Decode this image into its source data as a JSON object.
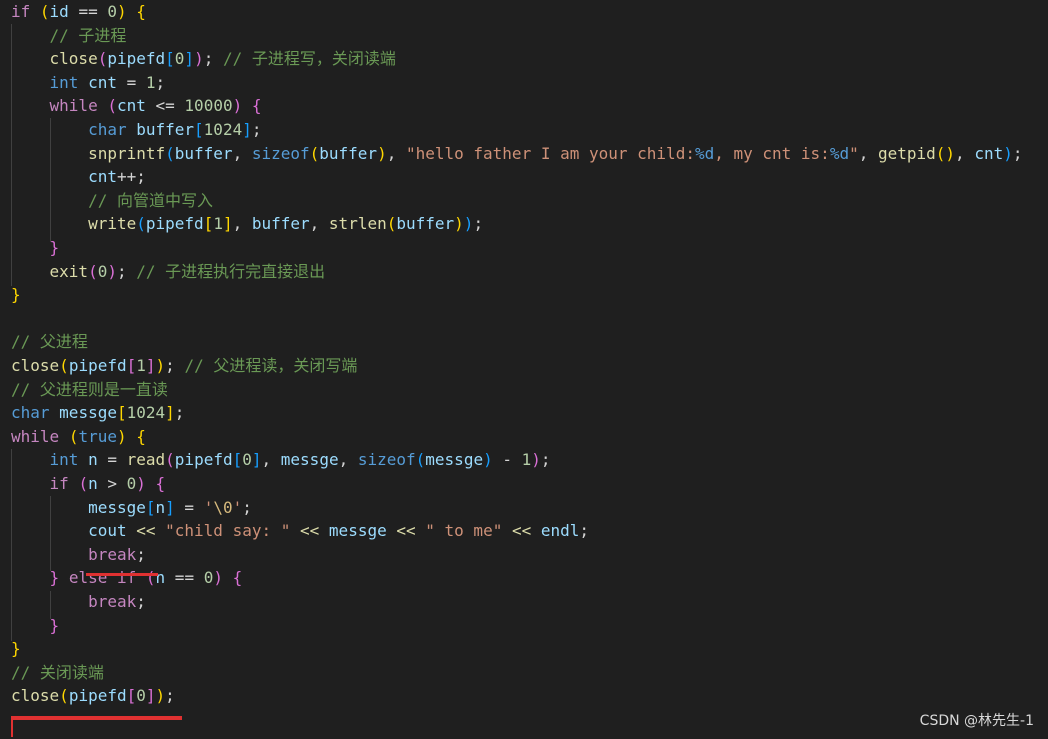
{
  "editor": {
    "watermark": "CSDN @林先生-1",
    "lines": [
      [
        [
          "k",
          "if"
        ],
        [
          "p",
          " "
        ],
        [
          "b1",
          "("
        ],
        [
          "v",
          "id"
        ],
        [
          "p",
          " == "
        ],
        [
          "n",
          "0"
        ],
        [
          "b1",
          ")"
        ],
        [
          "p",
          " "
        ],
        [
          "b1",
          "{"
        ]
      ],
      [
        [
          "p",
          "    "
        ],
        [
          "c",
          "// 子进程"
        ]
      ],
      [
        [
          "p",
          "    "
        ],
        [
          "f",
          "close"
        ],
        [
          "b2",
          "("
        ],
        [
          "v",
          "pipefd"
        ],
        [
          "b3",
          "["
        ],
        [
          "n",
          "0"
        ],
        [
          "b3",
          "]"
        ],
        [
          "b2",
          ")"
        ],
        [
          "p",
          "; "
        ],
        [
          "c",
          "// 子进程写，关闭读端"
        ]
      ],
      [
        [
          "p",
          "    "
        ],
        [
          "t",
          "int"
        ],
        [
          "p",
          " "
        ],
        [
          "v",
          "cnt"
        ],
        [
          "p",
          " = "
        ],
        [
          "n",
          "1"
        ],
        [
          "p",
          ";"
        ]
      ],
      [
        [
          "p",
          "    "
        ],
        [
          "k",
          "while"
        ],
        [
          "p",
          " "
        ],
        [
          "b2",
          "("
        ],
        [
          "v",
          "cnt"
        ],
        [
          "p",
          " <= "
        ],
        [
          "n",
          "10000"
        ],
        [
          "b2",
          ")"
        ],
        [
          "p",
          " "
        ],
        [
          "b2",
          "{"
        ]
      ],
      [
        [
          "p",
          "        "
        ],
        [
          "t",
          "char"
        ],
        [
          "p",
          " "
        ],
        [
          "v",
          "buffer"
        ],
        [
          "b3",
          "["
        ],
        [
          "n",
          "1024"
        ],
        [
          "b3",
          "]"
        ],
        [
          "p",
          ";"
        ]
      ],
      [
        [
          "p",
          "        "
        ],
        [
          "f",
          "snprintf"
        ],
        [
          "b3",
          "("
        ],
        [
          "v",
          "buffer"
        ],
        [
          "p",
          ", "
        ],
        [
          "t",
          "sizeof"
        ],
        [
          "b1",
          "("
        ],
        [
          "v",
          "buffer"
        ],
        [
          "b1",
          ")"
        ],
        [
          "p",
          ", "
        ],
        [
          "s",
          "\"hello father I am your child:"
        ],
        [
          "t",
          "%d"
        ],
        [
          "s",
          ", my cnt is:"
        ],
        [
          "t",
          "%d"
        ],
        [
          "s",
          "\""
        ],
        [
          "p",
          ", "
        ],
        [
          "f",
          "getpid"
        ],
        [
          "b1",
          "()"
        ],
        [
          "p",
          ", "
        ],
        [
          "v",
          "cnt"
        ],
        [
          "b3",
          ")"
        ],
        [
          "p",
          ";"
        ]
      ],
      [
        [
          "p",
          "        "
        ],
        [
          "v",
          "cnt"
        ],
        [
          "p",
          "++;"
        ]
      ],
      [
        [
          "p",
          "        "
        ],
        [
          "c",
          "// 向管道中写入"
        ]
      ],
      [
        [
          "p",
          "        "
        ],
        [
          "f",
          "write"
        ],
        [
          "b3",
          "("
        ],
        [
          "v",
          "pipefd"
        ],
        [
          "b1",
          "["
        ],
        [
          "n",
          "1"
        ],
        [
          "b1",
          "]"
        ],
        [
          "p",
          ", "
        ],
        [
          "v",
          "buffer"
        ],
        [
          "p",
          ", "
        ],
        [
          "f",
          "strlen"
        ],
        [
          "b1",
          "("
        ],
        [
          "v",
          "buffer"
        ],
        [
          "b1",
          ")"
        ],
        [
          "b3",
          ")"
        ],
        [
          "p",
          ";"
        ]
      ],
      [
        [
          "p",
          "    "
        ],
        [
          "b2",
          "}"
        ]
      ],
      [
        [
          "p",
          "    "
        ],
        [
          "f",
          "exit"
        ],
        [
          "b2",
          "("
        ],
        [
          "n",
          "0"
        ],
        [
          "b2",
          ")"
        ],
        [
          "p",
          "; "
        ],
        [
          "c",
          "// 子进程执行完直接退出"
        ]
      ],
      [
        [
          "b1",
          "}"
        ]
      ],
      [
        [
          "p",
          ""
        ]
      ],
      [
        [
          "c",
          "// 父进程"
        ]
      ],
      [
        [
          "f",
          "close"
        ],
        [
          "b1",
          "("
        ],
        [
          "v",
          "pipefd"
        ],
        [
          "b2",
          "["
        ],
        [
          "n",
          "1"
        ],
        [
          "b2",
          "]"
        ],
        [
          "b1",
          ")"
        ],
        [
          "p",
          "; "
        ],
        [
          "c",
          "// 父进程读，关闭写端"
        ]
      ],
      [
        [
          "c",
          "// 父进程则是一直读"
        ]
      ],
      [
        [
          "t",
          "char"
        ],
        [
          "p",
          " "
        ],
        [
          "v",
          "messge"
        ],
        [
          "b1",
          "["
        ],
        [
          "n",
          "1024"
        ],
        [
          "b1",
          "]"
        ],
        [
          "p",
          ";"
        ]
      ],
      [
        [
          "k",
          "while"
        ],
        [
          "p",
          " "
        ],
        [
          "b1",
          "("
        ],
        [
          "t",
          "true"
        ],
        [
          "b1",
          ")"
        ],
        [
          "p",
          " "
        ],
        [
          "b1",
          "{"
        ]
      ],
      [
        [
          "p",
          "    "
        ],
        [
          "t",
          "int"
        ],
        [
          "p",
          " "
        ],
        [
          "v",
          "n"
        ],
        [
          "p",
          " = "
        ],
        [
          "f",
          "read"
        ],
        [
          "b2",
          "("
        ],
        [
          "v",
          "pipefd"
        ],
        [
          "b3",
          "["
        ],
        [
          "n",
          "0"
        ],
        [
          "b3",
          "]"
        ],
        [
          "p",
          ", "
        ],
        [
          "v",
          "messge"
        ],
        [
          "p",
          ", "
        ],
        [
          "t",
          "sizeof"
        ],
        [
          "b3",
          "("
        ],
        [
          "v",
          "messge"
        ],
        [
          "b3",
          ")"
        ],
        [
          "p",
          " - "
        ],
        [
          "n",
          "1"
        ],
        [
          "b2",
          ")"
        ],
        [
          "p",
          ";"
        ]
      ],
      [
        [
          "p",
          "    "
        ],
        [
          "k",
          "if"
        ],
        [
          "p",
          " "
        ],
        [
          "b2",
          "("
        ],
        [
          "v",
          "n"
        ],
        [
          "p",
          " > "
        ],
        [
          "n",
          "0"
        ],
        [
          "b2",
          ")"
        ],
        [
          "p",
          " "
        ],
        [
          "b2",
          "{"
        ]
      ],
      [
        [
          "p",
          "        "
        ],
        [
          "v",
          "messge"
        ],
        [
          "b3",
          "["
        ],
        [
          "v",
          "n"
        ],
        [
          "b3",
          "]"
        ],
        [
          "p",
          " = "
        ],
        [
          "s",
          "'"
        ],
        [
          "e",
          "\\0"
        ],
        [
          "s",
          "'"
        ],
        [
          "p",
          ";"
        ]
      ],
      [
        [
          "p",
          "        "
        ],
        [
          "v",
          "cout"
        ],
        [
          "p",
          " "
        ],
        [
          "f",
          "<<"
        ],
        [
          "p",
          " "
        ],
        [
          "s",
          "\"child say: \""
        ],
        [
          "p",
          " "
        ],
        [
          "f",
          "<<"
        ],
        [
          "p",
          " "
        ],
        [
          "v",
          "messge"
        ],
        [
          "p",
          " "
        ],
        [
          "f",
          "<<"
        ],
        [
          "p",
          " "
        ],
        [
          "s",
          "\" to me\""
        ],
        [
          "p",
          " "
        ],
        [
          "f",
          "<<"
        ],
        [
          "p",
          " "
        ],
        [
          "v",
          "endl"
        ],
        [
          "p",
          ";"
        ]
      ],
      [
        [
          "p",
          "        "
        ],
        [
          "k",
          "break"
        ],
        [
          "p",
          ";"
        ]
      ],
      [
        [
          "p",
          "    "
        ],
        [
          "b2",
          "}"
        ],
        [
          "p",
          " "
        ],
        [
          "k",
          "else"
        ],
        [
          "p",
          " "
        ],
        [
          "k",
          "if"
        ],
        [
          "p",
          " "
        ],
        [
          "b2",
          "("
        ],
        [
          "v",
          "n"
        ],
        [
          "p",
          " == "
        ],
        [
          "n",
          "0"
        ],
        [
          "b2",
          ")"
        ],
        [
          "p",
          " "
        ],
        [
          "b2",
          "{"
        ]
      ],
      [
        [
          "p",
          "        "
        ],
        [
          "k",
          "break"
        ],
        [
          "p",
          ";"
        ]
      ],
      [
        [
          "p",
          "    "
        ],
        [
          "b2",
          "}"
        ]
      ],
      [
        [
          "b1",
          "}"
        ]
      ],
      [
        [
          "c",
          "// 关闭读端"
        ]
      ],
      [
        [
          "f",
          "close"
        ],
        [
          "b1",
          "("
        ],
        [
          "v",
          "pipefd"
        ],
        [
          "b2",
          "["
        ],
        [
          "n",
          "0"
        ],
        [
          "b2",
          "]"
        ],
        [
          "b1",
          ")"
        ],
        [
          "p",
          ";"
        ]
      ],
      [
        [
          "p",
          ""
        ]
      ]
    ]
  }
}
